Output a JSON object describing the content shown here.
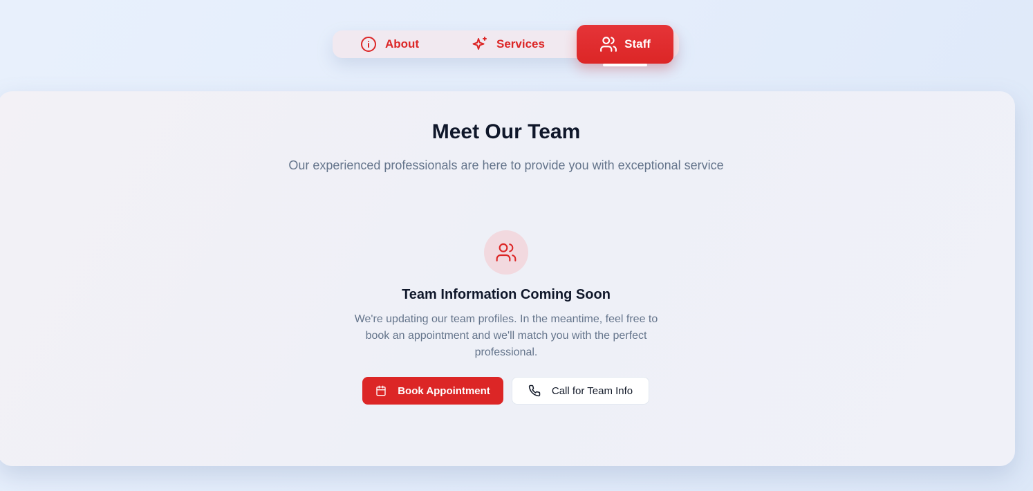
{
  "tabs": {
    "about": {
      "label": "About",
      "icon": "info-icon"
    },
    "services": {
      "label": "Services",
      "icon": "sparkles-icon"
    },
    "staff": {
      "label": "Staff",
      "icon": "users-icon",
      "active": true
    }
  },
  "section": {
    "title": "Meet Our Team",
    "subtitle": "Our experienced professionals are here to provide you with exceptional service"
  },
  "empty_state": {
    "icon": "users-icon",
    "title": "Team Information Coming Soon",
    "description": "We're updating our team profiles. In the meantime, feel free to book an appointment and we'll match you with the perfect professional."
  },
  "actions": {
    "book": {
      "label": "Book Appointment",
      "icon": "calendar-icon"
    },
    "call": {
      "label": "Call for Team Info",
      "icon": "phone-icon"
    }
  },
  "colors": {
    "accent": "#dc2626",
    "heading": "#0f172a",
    "muted": "#64748b",
    "icon_bg": "#f2d9df"
  }
}
